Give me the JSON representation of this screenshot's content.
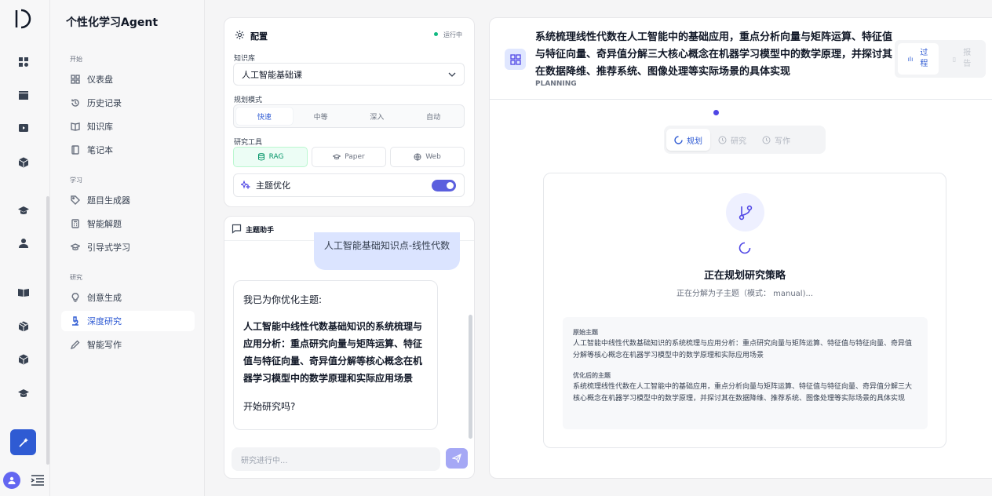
{
  "app": {
    "title": "个性化学习Agent",
    "active_color": "#2f5bd3"
  },
  "rail_icons": [
    "dashboard-icon",
    "clapper-icon",
    "play-icon",
    "cube-icon",
    "graduation-cap-icon",
    "user-icon",
    "book-open-icon",
    "package-icon",
    "cube-icon",
    "graduation-cap-icon"
  ],
  "sidebar": {
    "sections": [
      {
        "label": "开始",
        "items": [
          {
            "label": "仪表盘",
            "icon": "grid-icon"
          },
          {
            "label": "历史记录",
            "icon": "history-icon"
          },
          {
            "label": "知识库",
            "icon": "book-icon"
          },
          {
            "label": "笔记本",
            "icon": "notebook-icon"
          }
        ]
      },
      {
        "label": "学习",
        "items": [
          {
            "label": "题目生成器",
            "icon": "tag-icon"
          },
          {
            "label": "智能解题",
            "icon": "calculator-icon"
          },
          {
            "label": "引导式学习",
            "icon": "graduation-cap-icon"
          }
        ]
      },
      {
        "label": "研究",
        "items": [
          {
            "label": "创意生成",
            "icon": "lightbulb-icon"
          },
          {
            "label": "深度研究",
            "icon": "microscope-icon",
            "active": true
          },
          {
            "label": "智能写作",
            "icon": "pen-icon"
          }
        ]
      }
    ]
  },
  "config": {
    "title": "配置",
    "status": "运行中",
    "kb_label": "知识库",
    "kb_value": "人工智能基础课",
    "mode_label": "规划模式",
    "modes": [
      "快速",
      "中等",
      "深入",
      "自动"
    ],
    "mode_selected": "快速",
    "tools_label": "研究工具",
    "tools": [
      {
        "label": "RAG",
        "on": true
      },
      {
        "label": "Paper",
        "on": false
      },
      {
        "label": "Web",
        "on": false
      }
    ],
    "topic_opt_label": "主题优化",
    "topic_opt_on": true
  },
  "chat": {
    "title": "主题助手",
    "user_msg": "人工智能基础知识点-线性代数",
    "ai_intro": "我已为你优化主题:",
    "ai_topic": "人工智能中线性代数基础知识的系统梳理与应用分析：重点研究向量与矩阵运算、特征值与特征向量、奇异值分解等核心概念在机器学习模型中的数学原理和实际应用场景",
    "ai_question": "开始研究吗?",
    "input_placeholder": "研究进行中..."
  },
  "research": {
    "title": "系统梳理线性代数在人工智能中的基础应用，重点分析向量与矩阵运算、特征值与特征向量、奇异值分解三大核心概念在机器学习模型中的数学原理，并探讨其在数据降维、推荐系统、图像处理等实际场景的具体实现",
    "stage": "PLANNING",
    "view_tabs": [
      "过程",
      "报告"
    ],
    "steps": [
      "规划",
      "研究",
      "写作"
    ],
    "step_active": "规划",
    "status_title": "正在规划研究策略",
    "status_sub": "正在分解为子主题（模式： manual)...",
    "orig_label": "原始主题",
    "orig_text": "人工智能中线性代数基础知识的系统梳理与应用分析：重点研究向量与矩阵运算、特征值与特征向量、奇异值分解等核心概念在机器学习模型中的数学原理和实际应用场景",
    "opt_label": "优化后的主题",
    "opt_text": "系统梳理线性代数在人工智能中的基础应用，重点分析向量与矩阵运算、特征值与特征向量、奇异值分解三大核心概念在机器学习模型中的数学原理，并探讨其在数据降维、推荐系统、图像处理等实际场景的具体实现"
  }
}
